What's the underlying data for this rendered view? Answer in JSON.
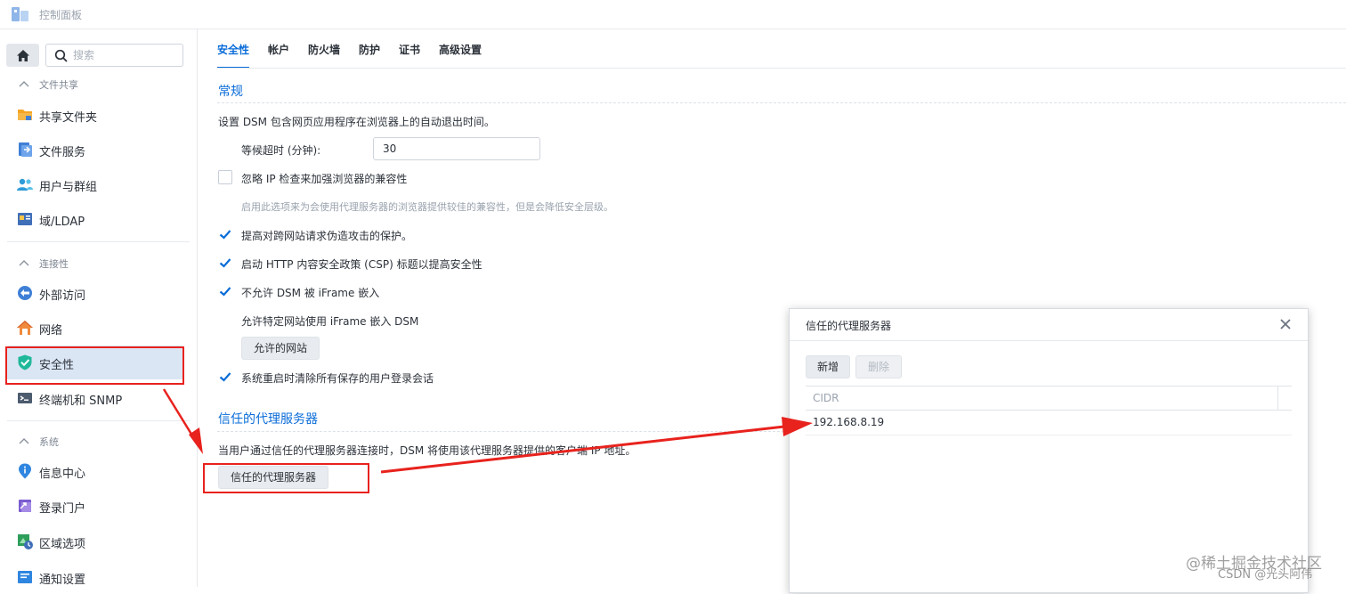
{
  "window": {
    "title": "控制面板"
  },
  "sidebar": {
    "search_placeholder": "搜索",
    "groups": [
      {
        "label": "文件共享",
        "items": [
          "共享文件夹",
          "文件服务",
          "用户与群组",
          "域/LDAP"
        ]
      },
      {
        "label": "连接性",
        "items": [
          "外部访问",
          "网络",
          "安全性",
          "终端机和 SNMP"
        ]
      },
      {
        "label": "系统",
        "items": [
          "信息中心",
          "登录门户",
          "区域选项",
          "通知设置"
        ]
      }
    ],
    "active_item": "安全性"
  },
  "tabs": [
    "安全性",
    "帐户",
    "防火墙",
    "防护",
    "证书",
    "高级设置"
  ],
  "active_tab": "安全性",
  "general": {
    "title": "常规",
    "logout_desc": "设置 DSM 包含网页应用程序在浏览器上的自动退出时间。",
    "timeout_label": "等候超时 (分钟):",
    "timeout_value": "30",
    "ignore_ip_label": "忽略 IP 检查来加强浏览器的兼容性",
    "ignore_ip_checked": false,
    "ignore_ip_hint": "启用此选项来为会使用代理服务器的浏览器提供较佳的兼容性，但是会降低安全层级。",
    "csrf_label": "提高对跨网站请求伪造攻击的保护。",
    "csrf_checked": true,
    "csp_label": "启动 HTTP 内容安全政策 (CSP) 标题以提高安全性",
    "csp_checked": true,
    "iframe_label": "不允许 DSM 被 iFrame 嵌入",
    "iframe_checked": true,
    "iframe_allow_label": "允许特定网站使用 iFrame 嵌入 DSM",
    "allowed_sites_button": "允许的网站",
    "clear_sessions_label": "系统重启时清除所有保存的用户登录会话",
    "clear_sessions_checked": true
  },
  "trusted_proxy": {
    "title": "信任的代理服务器",
    "desc": "当用户通过信任的代理服务器连接时，DSM 将使用该代理服务器提供的客户端 IP 地址。",
    "button": "信任的代理服务器"
  },
  "dialog": {
    "title": "信任的代理服务器",
    "add_button": "新增",
    "delete_button": "删除",
    "column_header": "CIDR",
    "rows": [
      "192.168.8.19"
    ]
  },
  "watermark": {
    "line1": "@稀土掘金技术社区",
    "line2": "CSDN @光头阿伟"
  },
  "colors": {
    "accent": "#0a6cd8",
    "annotation_red": "#e8221d",
    "active_bg": "#dbe6f4"
  }
}
